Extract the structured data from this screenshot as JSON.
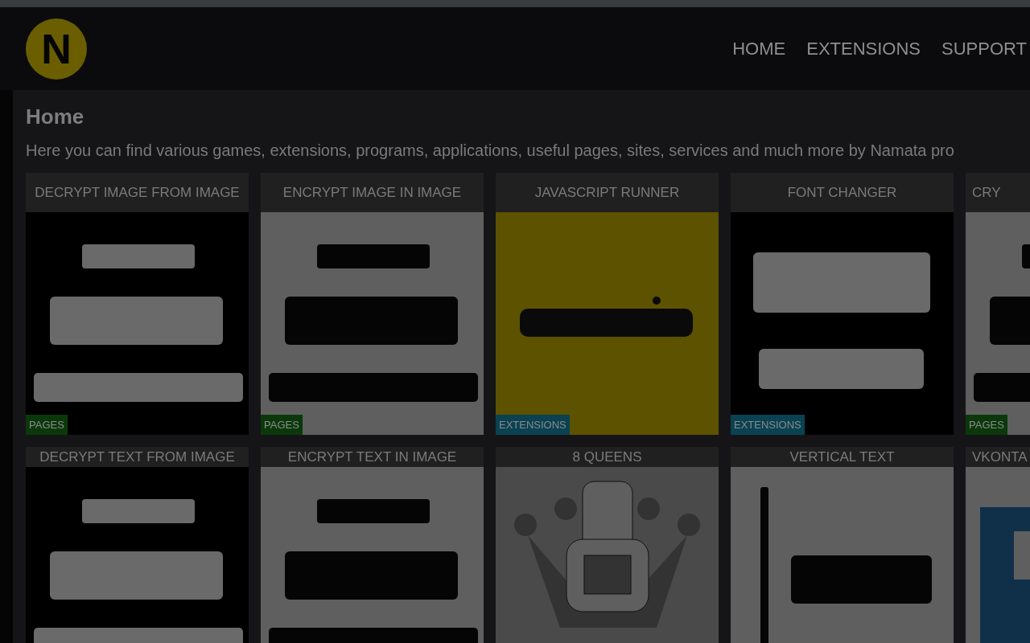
{
  "header": {
    "logo": "N",
    "nav": [
      "HOME",
      "EXTENSIONS",
      "SUPPORT"
    ]
  },
  "page": {
    "title": "Home",
    "description": "Here you can find various games, extensions, programs, applications, useful pages, sites, services and much more by Namata pro"
  },
  "cards": [
    {
      "title": "DECRYPT IMAGE FROM IMAGE",
      "tag": {
        "label": "PAGES",
        "kind": "pages"
      }
    },
    {
      "title": "ENCRYPT IMAGE IN IMAGE",
      "tag": {
        "label": "PAGES",
        "kind": "pages"
      }
    },
    {
      "title": "JAVASCRIPT RUNNER",
      "tag": {
        "label": "EXTENSIONS",
        "kind": "extensions"
      }
    },
    {
      "title": "FONT CHANGER",
      "tag": {
        "label": "EXTENSIONS",
        "kind": "extensions"
      }
    },
    {
      "title": "CRY",
      "tag": {
        "label": "PAGES",
        "kind": "pages"
      }
    },
    {
      "title": "DECRYPT TEXT FROM IMAGE"
    },
    {
      "title": "ENCRYPT TEXT IN IMAGE"
    },
    {
      "title": "8 QUEENS"
    },
    {
      "title": "VERTICAL TEXT"
    },
    {
      "title": "VKONTA"
    }
  ]
}
